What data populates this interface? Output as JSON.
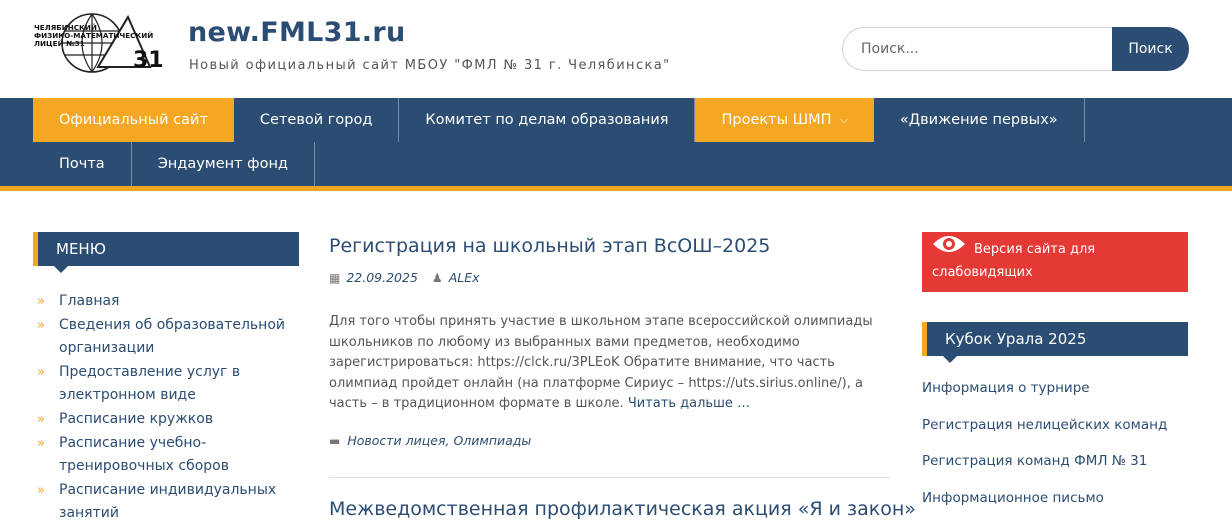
{
  "header": {
    "logo_lines": [
      "ЧЕЛЯБИНСКИЙ",
      "ФИЗИКО-МАТЕМАТИЧЕСКИЙ",
      "ЛИЦЕЙ №31"
    ],
    "logo_number": "31",
    "site_title": "new.FML31.ru",
    "tagline": "Новый официальный сайт МБОУ \"ФМЛ № 31 г. Челябинска\"",
    "search": {
      "placeholder": "Поиск...",
      "button_label": "Поиск"
    }
  },
  "nav": {
    "row1": [
      {
        "label": "Официальный сайт",
        "active": true
      },
      {
        "label": "Сетевой город",
        "active": false
      },
      {
        "label": "Комитет по делам образования",
        "active": false
      },
      {
        "label": "Проекты ШМП",
        "active": true,
        "dropdown": true
      },
      {
        "label": "«Движение первых»",
        "active": false
      }
    ],
    "row2": [
      {
        "label": "Почта"
      },
      {
        "label": "Эндаумент фонд"
      }
    ]
  },
  "left_sidebar": {
    "title": "МЕНЮ",
    "items": [
      "Главная",
      "Сведения об образовательной организации",
      "Предоставление услуг в электронном виде",
      "Расписание кружков",
      "Расписание учебно-тренировочных сборов",
      "Расписание индивидуальных занятий"
    ]
  },
  "main": {
    "posts": [
      {
        "title": "Регистрация на школьный этап ВсОШ–2025",
        "date": "22.09.2025",
        "author": "ALEx",
        "excerpt": "Для того чтобы принять участие в школьном этапе всероссийской олимпиады школьников по любому из выбранных вами предметов, необходимо зарегистрироваться:  https://clck.ru/3PLEoK Обратите внимание, что часть олимпиад пройдет онлайн (на платформе Сириус  – https://uts.sirius.online/), а часть – в традиционном формате в школе.",
        "read_more": "Читать дальше …",
        "categories": [
          "Новости лицея",
          "Олимпиады"
        ]
      },
      {
        "title": "Межведомственная профилактическая акция «Я и закон»"
      }
    ]
  },
  "right_sidebar": {
    "vision_button": "Версия сайта для слабовидящих",
    "widget_title": "Кубок Урала 2025",
    "links": [
      "Информация о турнире",
      "Регистрация нелицейских команд",
      "Регистрация команд ФМЛ № 31",
      "Информационное письмо"
    ]
  },
  "colors": {
    "primary": "#2b4d73",
    "accent": "#f5a623",
    "danger": "#e53935"
  }
}
